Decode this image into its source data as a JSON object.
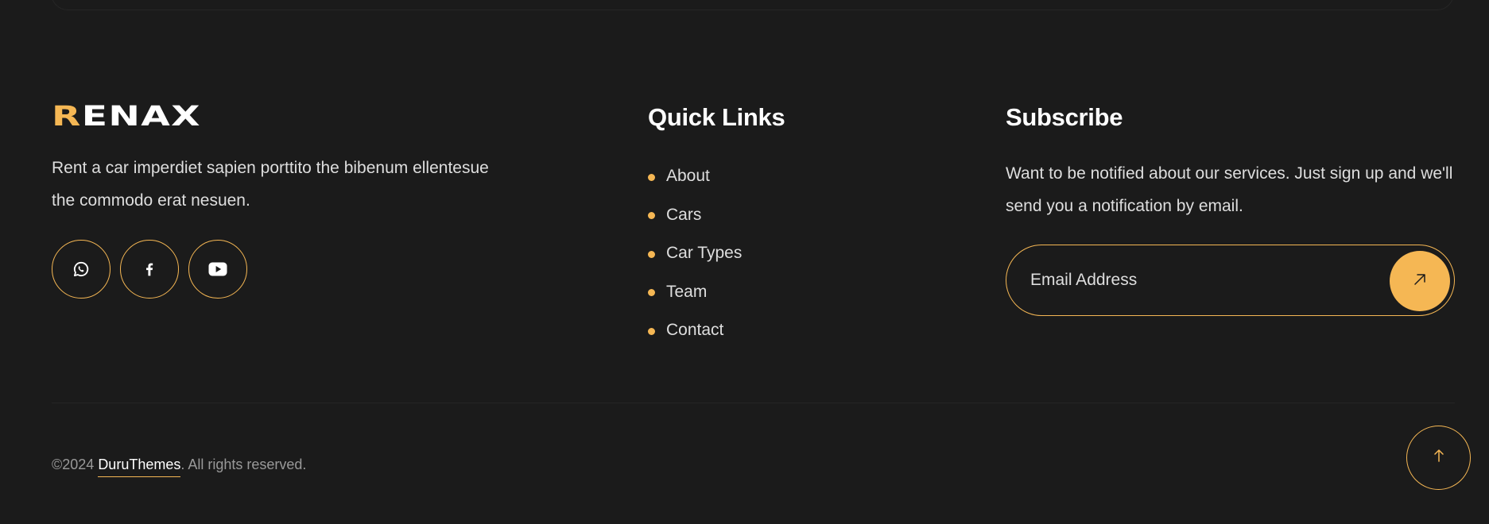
{
  "brand": {
    "logo_first": "R",
    "logo_rest": "ENAX",
    "description": "Rent a car imperdiet sapien porttito the bibenum ellentesue the commodo erat nesuen."
  },
  "social": [
    {
      "icon": "whatsapp-icon"
    },
    {
      "icon": "facebook-icon"
    },
    {
      "icon": "youtube-icon"
    }
  ],
  "quick_links": {
    "title": "Quick Links",
    "items": [
      {
        "label": "About"
      },
      {
        "label": "Cars"
      },
      {
        "label": "Car Types"
      },
      {
        "label": "Team"
      },
      {
        "label": "Contact"
      }
    ]
  },
  "subscribe": {
    "title": "Subscribe",
    "text": "Want to be notified about our services. Just sign up and we'll send you a notification by email.",
    "email_placeholder": "Email Address",
    "submit_icon": "arrow-up-right-icon"
  },
  "footer": {
    "copyright_prefix": "©2024 ",
    "copyright_brand": "DuruThemes",
    "copyright_suffix": ". All rights reserved.",
    "scroll_top_icon": "arrow-up-icon"
  },
  "colors": {
    "background": "#1b1b1b",
    "accent": "#f5b754",
    "text": "#dedede",
    "muted": "#999999"
  }
}
